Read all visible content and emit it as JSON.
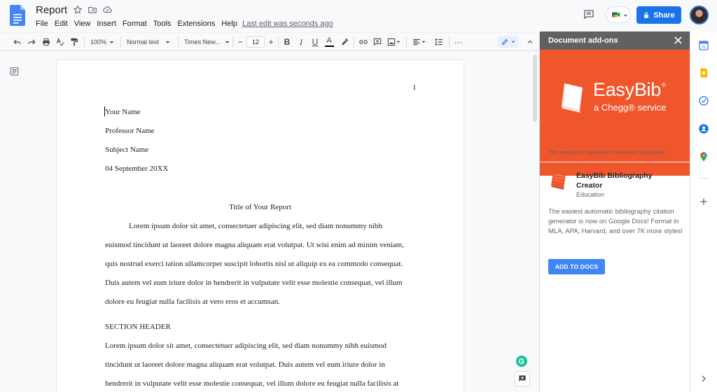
{
  "app": {
    "document_title": "Report",
    "last_edit": "Last edit was seconds ago",
    "share_label": "Share"
  },
  "menu": [
    "File",
    "Edit",
    "View",
    "Insert",
    "Format",
    "Tools",
    "Extensions",
    "Help"
  ],
  "toolbar": {
    "zoom": "100%",
    "style": "Normal text",
    "font": "Times New...",
    "font_size": "12"
  },
  "document": {
    "page_number": "1",
    "header_lines": [
      "Your Name",
      "Professor Name",
      "Subject Name",
      "04 September 20XX"
    ],
    "title": "Title of Your Report",
    "paragraph1": [
      "Lorem ipsum dolor sit amet, consectetuer adipiscing elit, sed diam nonummy nibh",
      "euismod tincidunt ut laoreet dolore magna aliquam erat volutpat. Ut wisi enim ad minim veniam,",
      "quis nostrud exerci tation ullamcorper suscipit lobortis nisl ut aliquip ex ea commodo consequat.",
      "Duis autem vel eum iriure dolor in hendrerit in vulputate velit esse molestie consequat, vel illum",
      "dolore eu feugiat nulla facilisis at vero eros et accumsan."
    ],
    "section_header": "SECTION HEADER",
    "paragraph2": [
      "Lorem ipsum dolor sit amet, consectetuer adipiscing elit, sed diam nonummy nibh euismod",
      "tincidunt ut laoreet dolore magna aliquam erat volutpat. Duis autem vel eum iriure dolor in",
      "hendrerit in vulputate velit esse molestie consequat, vel illum dolore eu feugiat nulla facilisis at"
    ]
  },
  "addon_panel": {
    "header": "Document add-ons",
    "brand": "EasyBib",
    "brand_reg": "®",
    "tagline": "a Chegg® service",
    "template_note": "This template is optimised to work with this add-on",
    "addon_name": "EasyBib Bibliography Creator",
    "addon_category": "Education",
    "addon_description": "The easiest automatic bibliography citation generator is now on Google Docs! Format in MLA, APA, Harvard, and over 7K more styles!",
    "add_button": "ADD TO DOCS"
  },
  "colors": {
    "share_blue": "#1a73e8",
    "easybib_orange": "#f0562c",
    "addon_header_gray": "#616161",
    "add_button_blue": "#4285f4"
  },
  "icons": {
    "side_panel": [
      "calendar-icon",
      "keep-icon",
      "tasks-icon",
      "contacts-icon",
      "maps-icon",
      "add-icon",
      "expand-chevron-icon"
    ]
  }
}
